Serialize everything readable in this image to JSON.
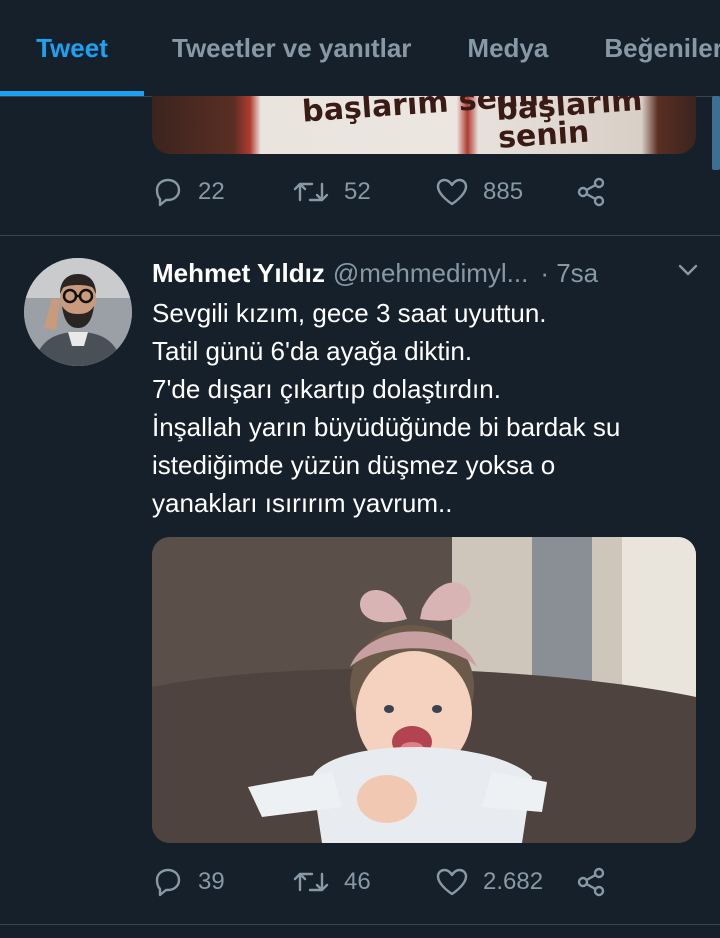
{
  "tabs": [
    {
      "label": "Tweet",
      "active": true
    },
    {
      "label": "Tweetler ve yanıtlar",
      "active": false
    },
    {
      "label": "Medya",
      "active": false
    },
    {
      "label": "Beğeniler",
      "active": false
    }
  ],
  "previous_tweet": {
    "image_text": [
      "başlarım senin",
      "başlarım senin"
    ],
    "actions": {
      "replies": "22",
      "retweets": "52",
      "likes": "885"
    }
  },
  "tweet": {
    "author_name": "Mehmet Yıldız",
    "handle": "@mehmedimyl...",
    "time": "· 7sa",
    "lines": [
      "Sevgili kızım, gece 3 saat uyuttun.",
      "Tatil günü 6'da ayağa diktin.",
      "7'de dışarı çıkartıp dolaştırdın.",
      "İnşallah yarın büyüdüğünde bi bardak su",
      "istediğimde yüzün düşmez yoksa o",
      "yanakları ısırırım yavrum.."
    ],
    "actions": {
      "replies": "39",
      "retweets": "46",
      "likes": "2.682"
    }
  },
  "colors": {
    "background": "#15202b",
    "accent": "#1da1f2",
    "muted": "#8899a6",
    "divider": "#38444d"
  }
}
